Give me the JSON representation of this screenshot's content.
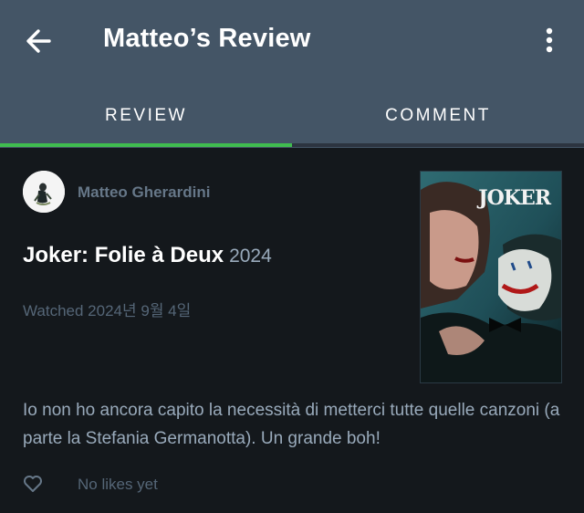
{
  "header": {
    "title": "Matteo’s Review",
    "back_icon": "arrow-left-icon",
    "menu_icon": "more-vertical-icon"
  },
  "tabs": [
    {
      "label": "REVIEW",
      "active": true
    },
    {
      "label": "COMMENT",
      "active": false
    }
  ],
  "review": {
    "author": "Matteo Gherardini",
    "film_title": "Joker: Folie à Deux",
    "film_year": "2024",
    "watched": "Watched 2024년 9월 4일",
    "text": "Io non ho ancora capito la necessità di metterci tutte quelle canzoni (a parte la Stefania Germanotta). Un grande boh!",
    "likes_text": "No likes yet",
    "poster_title": "JOKER"
  },
  "colors": {
    "appbar": "#445566",
    "background": "#14181c",
    "accent": "#40bc4f"
  }
}
